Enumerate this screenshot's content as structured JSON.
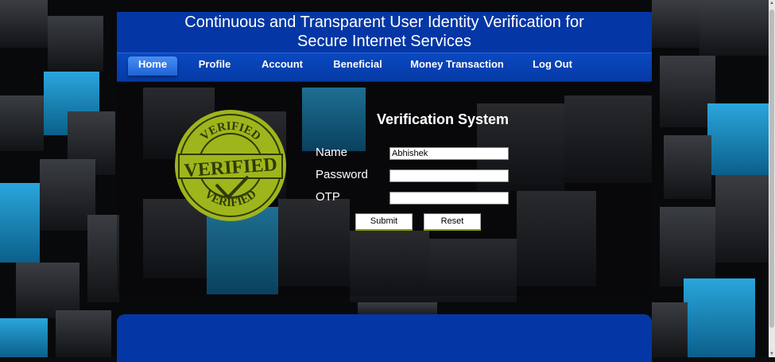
{
  "header": {
    "title_line1": "Continuous and Transparent User Identity Verification for",
    "title_line2": "Secure Internet Services"
  },
  "nav": {
    "items": [
      {
        "label": "Home",
        "active": true
      },
      {
        "label": "Profile"
      },
      {
        "label": "Account"
      },
      {
        "label": "Beneficial"
      },
      {
        "label": "Money Transaction"
      },
      {
        "label": "Log Out"
      }
    ]
  },
  "stamp": {
    "center_text": "VERIFIED",
    "ring_text_top": "VERIFIED",
    "ring_text_bottom": "VERIFIED",
    "color": "#9fb51c"
  },
  "form": {
    "title": "Verification System",
    "name_label": "Name",
    "name_value": "Abhishek",
    "password_label": "Password",
    "password_value": "",
    "otp_label": "OTP",
    "otp_value": "",
    "submit_label": "Submit",
    "reset_label": "Reset"
  },
  "colors": {
    "header_blue": "#0437a5",
    "nav_active": "#3b7fe8",
    "cube_blue": "#1a8fc9"
  }
}
